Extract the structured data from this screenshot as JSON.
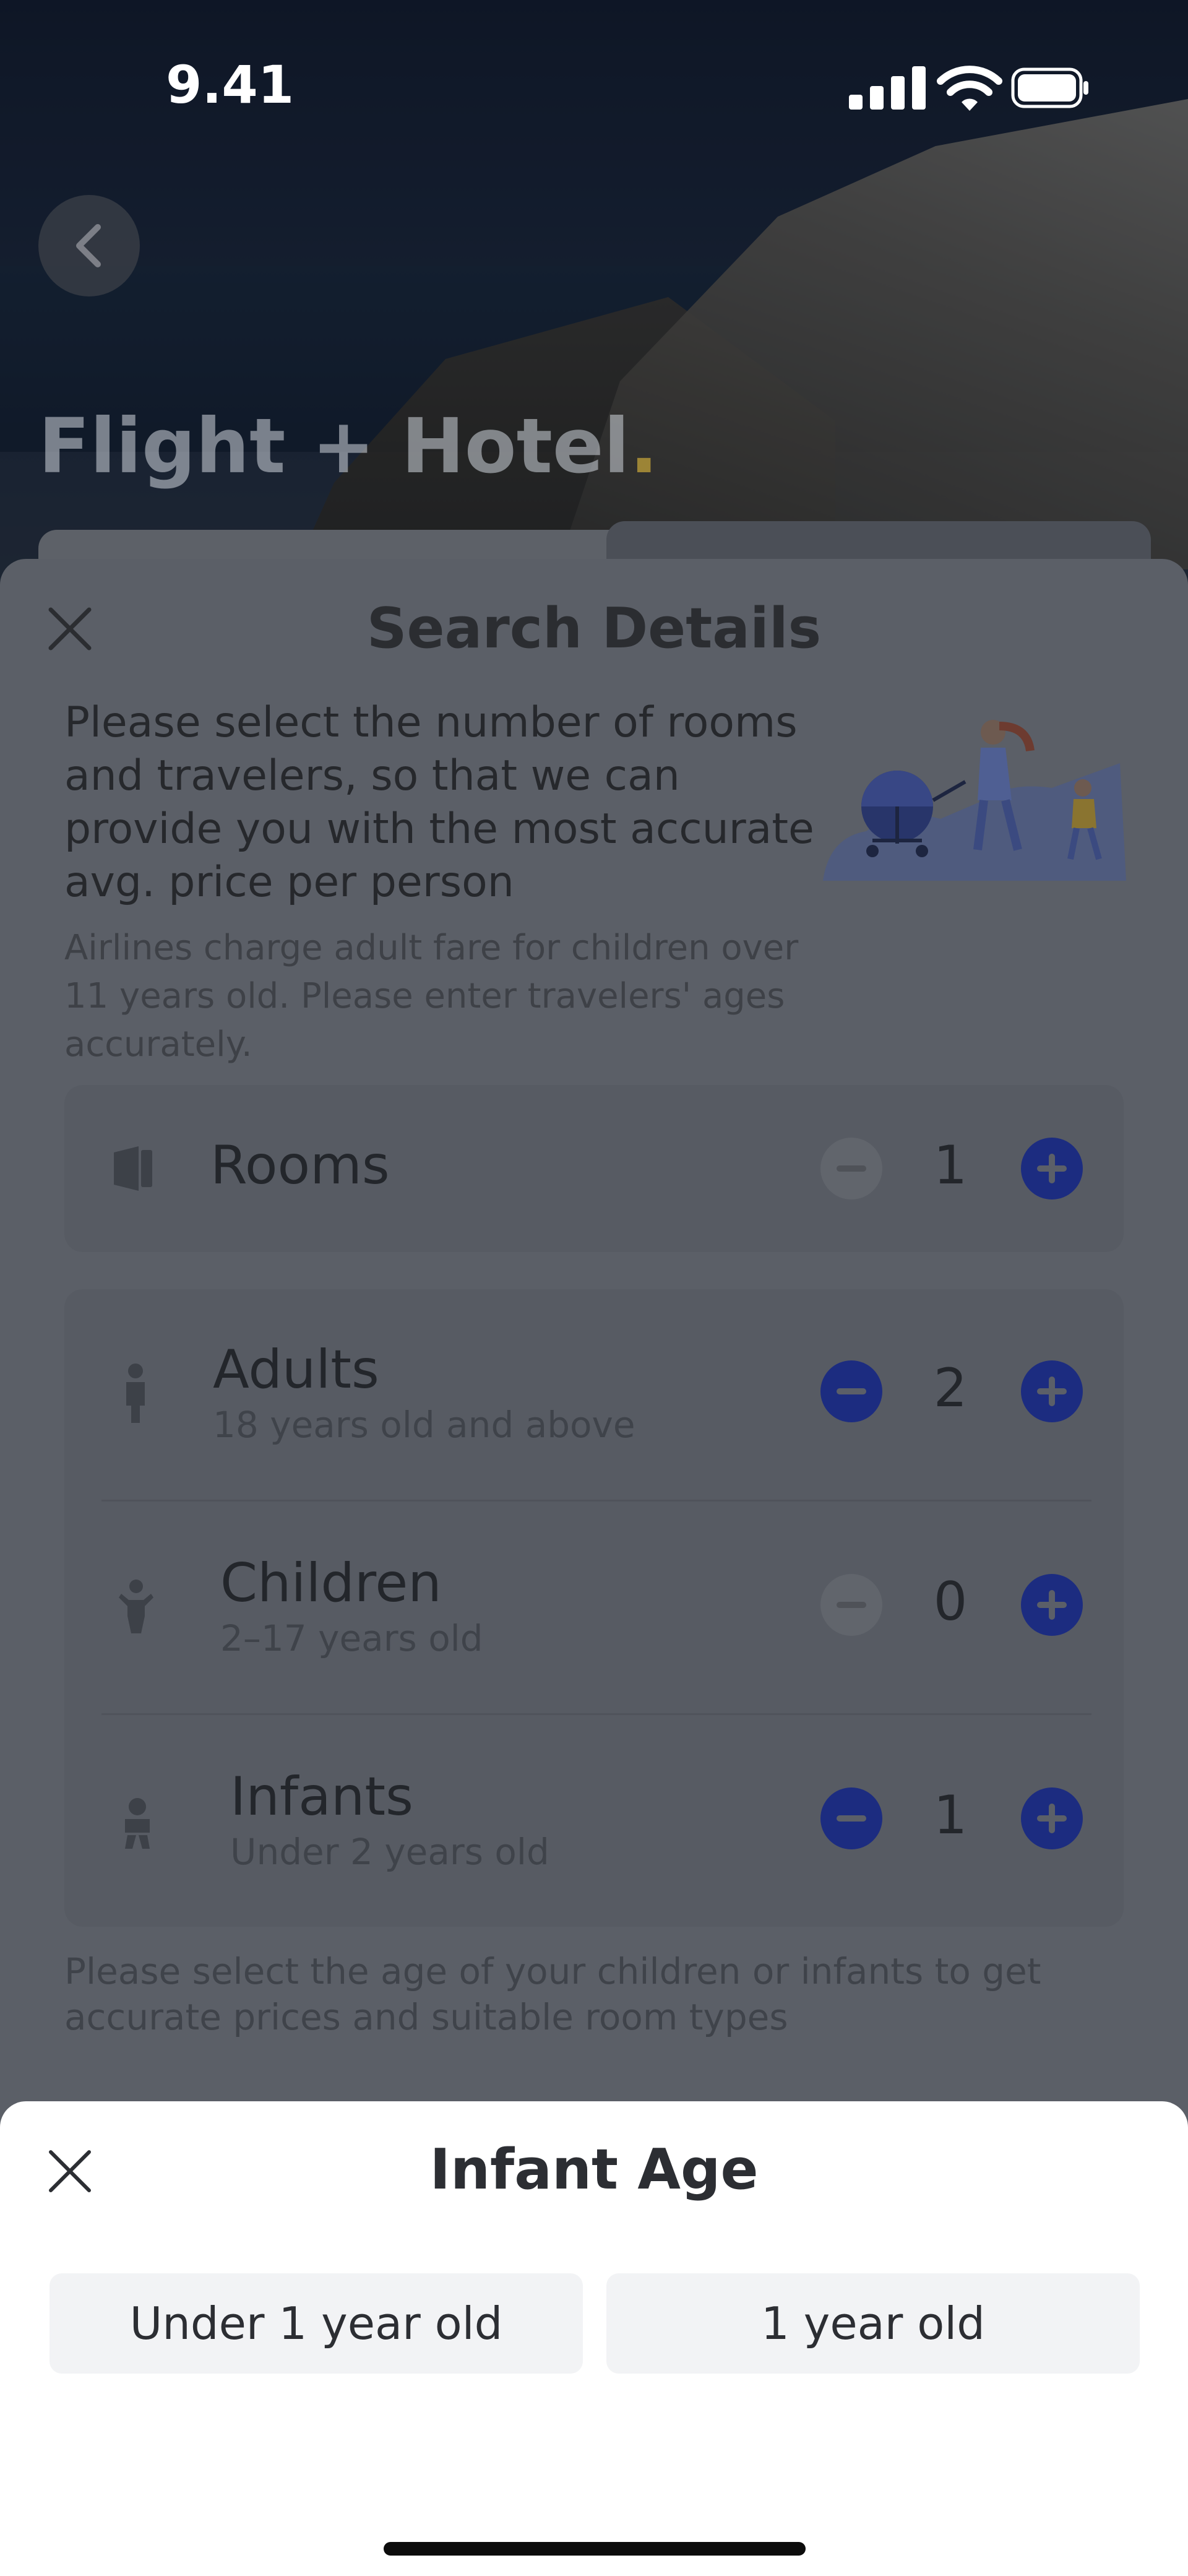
{
  "status_bar": {
    "time": "9.41"
  },
  "hero": {
    "title": "Flight + Hotel",
    "title_dot": "."
  },
  "search_details": {
    "title": "Search Details",
    "intro": "Please select the number of rooms and travelers, so that we can provide you with the most accurate avg. price per person",
    "note": "Airlines charge adult fare for children over 11 years old. Please enter travelers' ages accurately.",
    "rooms": {
      "label": "Rooms",
      "count": "1",
      "minus_enabled": false
    },
    "travelers": [
      {
        "label": "Adults",
        "sub": "18 years old and above",
        "count": "2",
        "minus_enabled": true,
        "icon": "adult-icon"
      },
      {
        "label": "Children",
        "sub": "2–17 years old",
        "count": "0",
        "minus_enabled": false,
        "icon": "child-icon"
      },
      {
        "label": "Infants",
        "sub": "Under 2 years old",
        "count": "1",
        "minus_enabled": true,
        "icon": "infant-icon"
      }
    ],
    "bottom_note": "Please select the age of your children or infants to get accurate prices and suitable room types"
  },
  "infant_age": {
    "title": "Infant Age",
    "options": [
      "Under 1 year old",
      "1 year old"
    ]
  },
  "colors": {
    "accent": "#1c2c80",
    "overlay_sheet": "#5b5f67",
    "panel": "#ffffff"
  }
}
